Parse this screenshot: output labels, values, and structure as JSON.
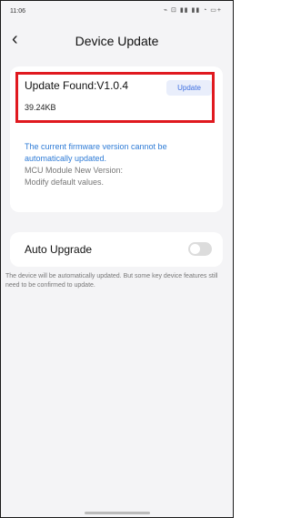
{
  "status_bar": {
    "time": "11:06",
    "icons_text": "⌁ ⊡ ▮▮ ▮▮ ◔ ▭+",
    "icons": [
      "vibrate-icon",
      "nfc-icon",
      "signal-icon",
      "signal-icon",
      "wifi-icon",
      "battery-icon"
    ]
  },
  "nav": {
    "back_glyph": "‹",
    "title": "Device Update"
  },
  "update_card": {
    "found_text": "Update Found:V1.0.4",
    "update_button": "Update",
    "size": "39.24KB",
    "notice_blue": "The current firmware version cannot be automatically updated.",
    "notice_line1": "MCU Module New Version:",
    "notice_line2": "Modify default values."
  },
  "auto_upgrade": {
    "label": "Auto Upgrade",
    "enabled": false,
    "note": "The device will be automatically updated. But some key device features still need to be confirmed to update."
  },
  "colors": {
    "highlight": "#e0191f",
    "accent_blue": "#2e7bd6",
    "button_bg": "#e9eefb"
  }
}
